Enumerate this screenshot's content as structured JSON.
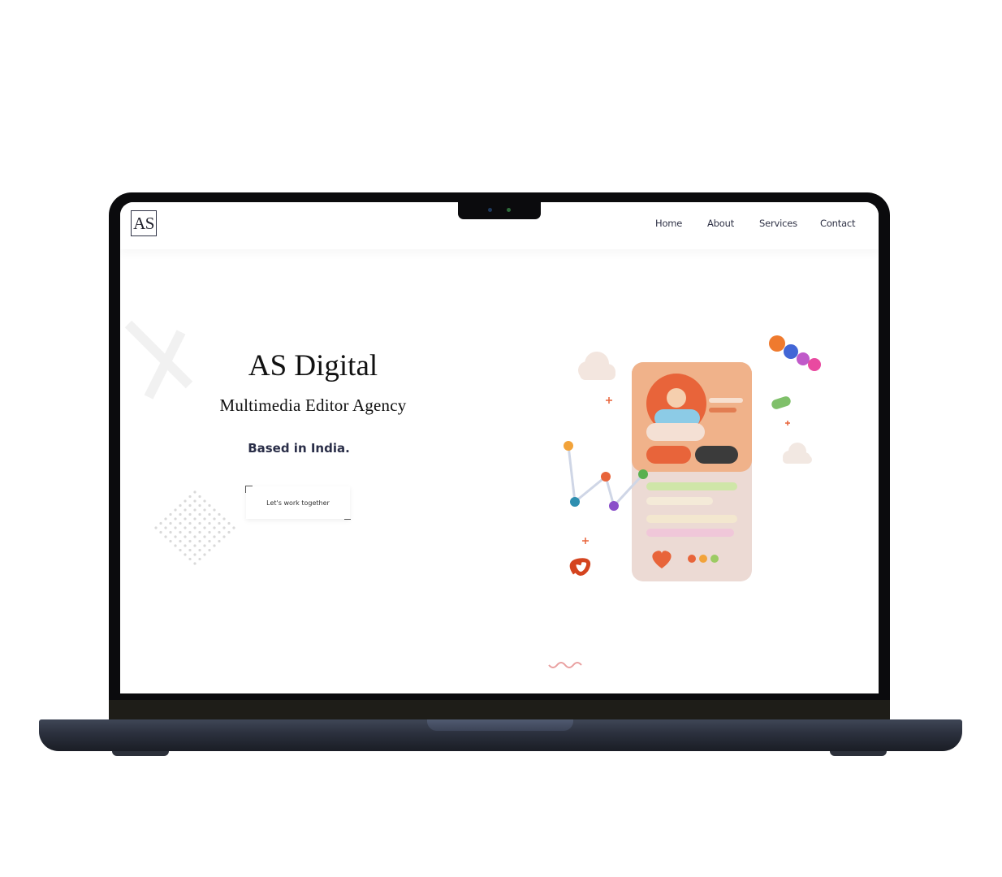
{
  "site": {
    "logo_text": "AS",
    "nav": [
      {
        "label": "Home"
      },
      {
        "label": "About"
      },
      {
        "label": "Services"
      },
      {
        "label": "Contact"
      }
    ]
  },
  "hero": {
    "title": "AS Digital",
    "subtitle": "Multimedia Editor Agency",
    "location": "Based in India.",
    "cta_label": "Let's work together"
  },
  "colors": {
    "brand_dark": "#2a2e48",
    "accent_orange": "#e8643a",
    "phone_body": "#f0b28a"
  },
  "icons": [
    "scroll-down-wave-icon",
    "phone-illustration",
    "dot-pattern"
  ]
}
